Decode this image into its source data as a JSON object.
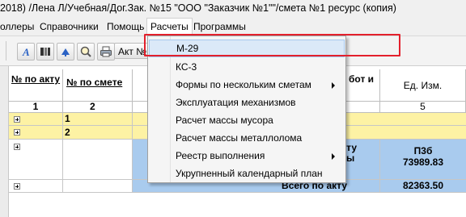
{
  "window": {
    "title": "2018) /Лена Л/Учебная/Дог.Зак. №15  \"ООО \"Заказчик №1\"\"/смета №1 ресурс (копия)"
  },
  "menubar": {
    "items": [
      {
        "label": "оллеры"
      },
      {
        "label": "Справочники"
      },
      {
        "label": "Помощь"
      },
      {
        "label": "Расчеты"
      },
      {
        "label": "Программы"
      }
    ]
  },
  "toolbar": {
    "text_button": "Акт №"
  },
  "grid": {
    "headers": {
      "num_act": "№ по акту",
      "num_estimate": "№ по смете",
      "works_partial": "бот и",
      "unit": "Ед. Изм."
    },
    "header_numbers": {
      "col1": "1",
      "col2": "2",
      "col5": "5"
    },
    "rows": [
      {
        "col2": "1"
      },
      {
        "col2": "2"
      },
      {
        "summary_top": "кту",
        "summary_mid": "ты",
        "summary_bot": ")",
        "unit_code": "П3б",
        "unit_value": "73989.83"
      },
      {
        "total_label": "Всего по акту",
        "total_value": "82363.50"
      }
    ],
    "colors": {
      "yellow_row": "#fdf2a4",
      "blue_row": "#a9cbee",
      "header_bg": "#ffffff"
    }
  },
  "dropdown": {
    "items": [
      {
        "label": "М-29",
        "submenu": false,
        "highlighted": true
      },
      {
        "label": "КС-3",
        "submenu": false
      },
      {
        "label": "Формы по нескольким сметам",
        "submenu": true
      },
      {
        "label": "Эксплуатация механизмов",
        "submenu": false
      },
      {
        "label": "Расчет массы мусора",
        "submenu": false
      },
      {
        "label": "Расчет массы металлолома",
        "submenu": false
      },
      {
        "label": "Реестр выполнения",
        "submenu": true
      },
      {
        "label": "Укрупненный календарный план",
        "submenu": false
      }
    ]
  },
  "annotation": {
    "color": "#e3202c"
  }
}
